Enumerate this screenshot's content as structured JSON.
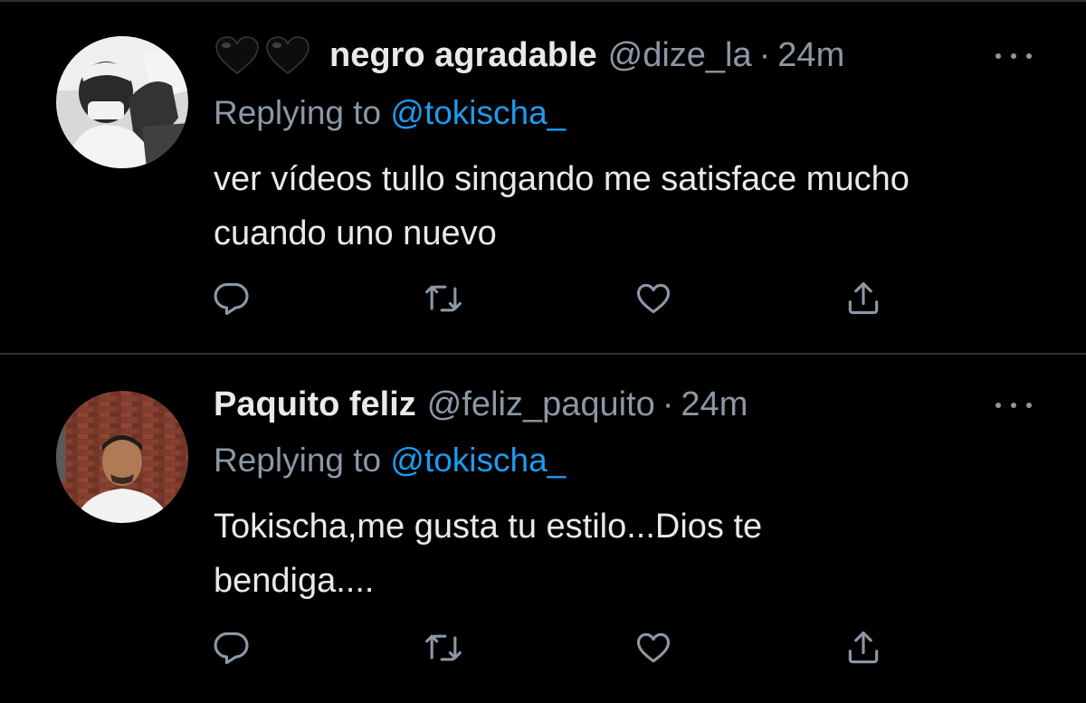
{
  "colors": {
    "background": "#000000",
    "text_primary": "#e7e9ea",
    "text_secondary": "#8b98a5",
    "mention": "#1d9bf0",
    "divider": "#2f3336"
  },
  "tweets": [
    {
      "display_name": "negro agradable",
      "name_prefix_icons": [
        "black-heart-icon",
        "black-heart-icon"
      ],
      "handle": "@dize_la",
      "separator": "·",
      "time": "24m",
      "replying_prefix": "Replying to",
      "replying_to": "@tokischa_",
      "text_lines": [
        "ver vídeos tullo singando me satisface mucho",
        "cuando uno nuevo"
      ],
      "avatar": "grayscale-photo-avatar",
      "actions": [
        "reply-icon",
        "retweet-icon",
        "like-icon",
        "share-icon"
      ]
    },
    {
      "display_name": "Paquito feliz",
      "handle": "@feliz_paquito",
      "separator": "·",
      "time": "24m",
      "replying_prefix": "Replying to",
      "replying_to": "@tokischa_",
      "text_lines": [
        "Tokischa,me gusta tu estilo...Dios te",
        "bendiga...."
      ],
      "avatar": "brick-wall-photo-avatar",
      "actions": [
        "reply-icon",
        "retweet-icon",
        "like-icon",
        "share-icon"
      ]
    }
  ]
}
